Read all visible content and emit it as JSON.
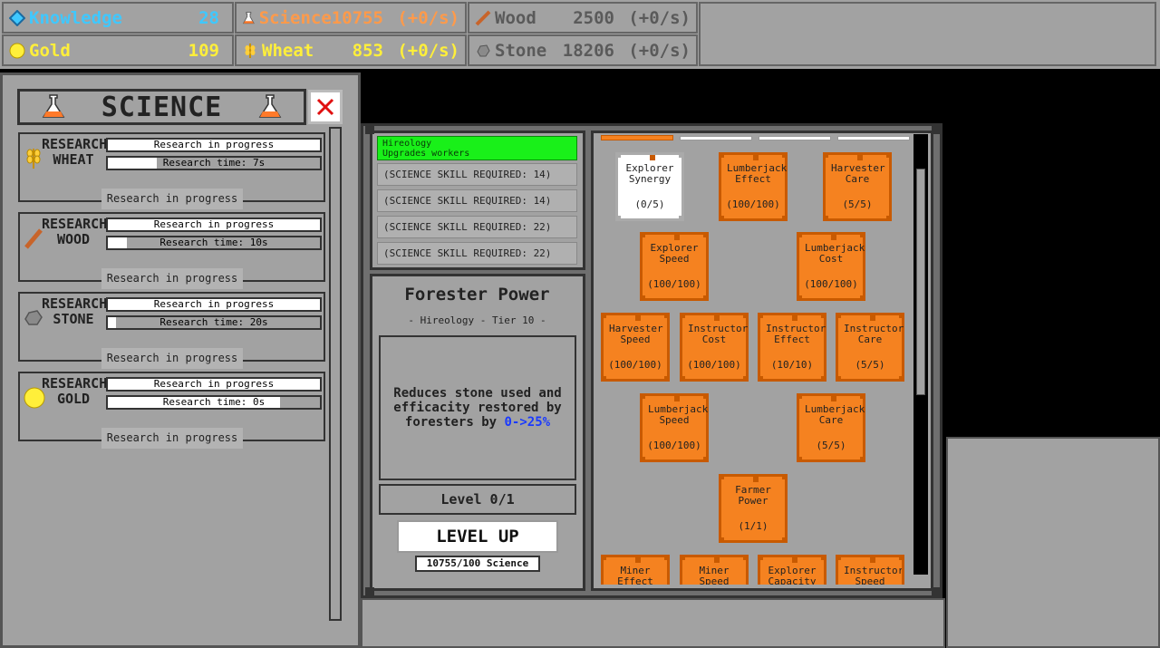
{
  "resources": {
    "knowledge": {
      "name": "Knowledge",
      "value": "28"
    },
    "gold": {
      "name": "Gold",
      "value": "109"
    },
    "science": {
      "name": "Science",
      "value": "10755",
      "rate": "(+0/s)"
    },
    "wheat": {
      "name": "Wheat",
      "value": "853",
      "rate": "(+0/s)"
    },
    "wood": {
      "name": "Wood",
      "value": "2500",
      "rate": "(+0/s)"
    },
    "stone": {
      "name": "Stone",
      "value": "18206",
      "rate": "(+0/s)"
    }
  },
  "science_panel": {
    "title": "SCIENCE",
    "close_icon": "close-x-icon",
    "research": [
      {
        "label1": "RESEARCH",
        "label2": "WHEAT",
        "status": "Research in progress",
        "time": "Research time: 7s",
        "progress": 0.23,
        "button": "Research in progress",
        "icon": "wheat-icon"
      },
      {
        "label1": "RESEARCH",
        "label2": "WOOD",
        "status": "Research in progress",
        "time": "Research time: 10s",
        "progress": 0.09,
        "button": "Research in progress",
        "icon": "wood-icon"
      },
      {
        "label1": "RESEARCH",
        "label2": "STONE",
        "status": "Research in progress",
        "time": "Research time: 20s",
        "progress": 0.04,
        "button": "Research in progress",
        "icon": "stone-icon"
      },
      {
        "label1": "RESEARCH",
        "label2": "GOLD",
        "status": "Research in progress",
        "time": "Research time: 0s",
        "progress": 0.81,
        "button": "Research in progress",
        "icon": "gold-icon"
      }
    ]
  },
  "skill_list": {
    "active_title": "Hireology",
    "active_subtitle": "Upgrades workers",
    "items": [
      "(SCIENCE SKILL REQUIRED: 14)",
      "(SCIENCE SKILL REQUIRED: 14)",
      "(SCIENCE SKILL REQUIRED: 22)",
      "(SCIENCE SKILL REQUIRED: 22)"
    ]
  },
  "detail": {
    "title": "Forester Power",
    "subtitle": "- Hireology - Tier 10 -",
    "desc_pre": "Reduces stone used and efficacity restored by foresters by ",
    "desc_hl": "0->25%",
    "level": "Level 0/1",
    "button": "LEVEL UP",
    "cost": "10755/100 Science"
  },
  "tree": {
    "nodes": [
      {
        "name": "Explorer Synergy",
        "level": "(0/5)",
        "state": "locked"
      },
      {
        "name": "Lumberjack Effect",
        "level": "(100/100)",
        "state": "owned"
      },
      {
        "name": "Harvester Care",
        "level": "(5/5)",
        "state": "owned"
      },
      {
        "name": "Explorer Speed",
        "level": "(100/100)",
        "state": "owned"
      },
      {
        "name": "Lumberjack Cost",
        "level": "(100/100)",
        "state": "owned"
      },
      {
        "name": "Harvester Speed",
        "level": "(100/100)",
        "state": "owned"
      },
      {
        "name": "Instructor Cost",
        "level": "(100/100)",
        "state": "owned"
      },
      {
        "name": "Instructor Effect",
        "level": "(10/10)",
        "state": "owned"
      },
      {
        "name": "Instructor Care",
        "level": "(5/5)",
        "state": "owned"
      },
      {
        "name": "Lumberjack Speed",
        "level": "(100/100)",
        "state": "owned"
      },
      {
        "name": "Lumberjack Care",
        "level": "(5/5)",
        "state": "owned"
      },
      {
        "name": "Farmer Power",
        "level": "(1/1)",
        "state": "owned"
      },
      {
        "name": "Miner Effect",
        "level": "",
        "state": "owned"
      },
      {
        "name": "Miner Speed",
        "level": "",
        "state": "owned"
      },
      {
        "name": "Explorer Capacity",
        "level": "",
        "state": "owned"
      },
      {
        "name": "Instructor Speed",
        "level": "",
        "state": "owned"
      }
    ]
  }
}
